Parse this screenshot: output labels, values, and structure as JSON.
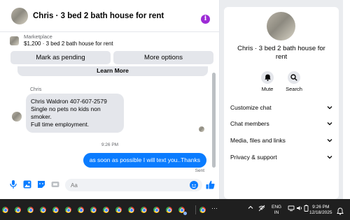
{
  "chat": {
    "title": "Chris · 3 bed 2 bath house for rent",
    "listing": {
      "source": "Marketplace",
      "detail": "$1,200 · 3 bed 2 bath house for rent"
    },
    "actions": {
      "pending": "Mark as pending",
      "more": "More options"
    },
    "peek_card_label": "Learn More",
    "sender_name": "Chris",
    "incoming_message": [
      "Chris Waldron 407-607-2579",
      "Single no pets no kids non smoker.",
      "Full time employment."
    ],
    "timestamp": "9:26 PM",
    "outgoing_message": "as soon as possible I will text you..Thanks",
    "sent_status": "Sent",
    "input_placeholder": "Aa"
  },
  "side_panel": {
    "title": "Chris · 3 bed 2 bath house for rent",
    "mute_label": "Mute",
    "search_label": "Search",
    "sections": [
      "Customize chat",
      "Chat members",
      "Media, files and links",
      "Privacy & support"
    ]
  },
  "taskbar": {
    "more": "···",
    "lang_1": "ENG",
    "lang_2": "IN",
    "time": "9:26 PM",
    "date": "12/18/2025"
  },
  "colors": {
    "accent": "#0a7cff",
    "info": "#9d2bd6",
    "bubble_in": "#e4e6eb",
    "taskbar": "#1f1f1f"
  }
}
